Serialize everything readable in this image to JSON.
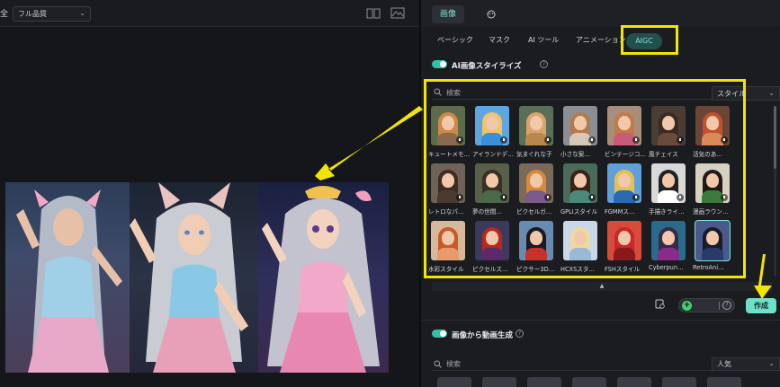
{
  "left_toolbar": {
    "label": "全",
    "quality": "フル品質",
    "split_icon": "split-view-icon",
    "image_icon": "snapshot-icon"
  },
  "preview": {
    "panels": [
      "original-photo",
      "illustration-style",
      "anime-style"
    ]
  },
  "top_tabs": {
    "image_tab": "画像",
    "color_icon": "palette-icon"
  },
  "sub_tabs": {
    "basic": "ベーシック",
    "mask": "マスク",
    "ai_tool": "AI ツール",
    "animation": "アニメーション",
    "aigc": "AIGC"
  },
  "section_style": {
    "title": "AI画像スタイライズ",
    "enabled": true
  },
  "search": {
    "placeholder": "検索",
    "sort": "スタイル"
  },
  "styles": [
    {
      "label": "キュートメモ…",
      "hair": "#c98a4a",
      "body": "#8a6a4a",
      "bg": "#5c6b4a"
    },
    {
      "label": "アイランドデ…",
      "hair": "#f2c46a",
      "body": "#3b8fd8",
      "bg": "#5fa6e0"
    },
    {
      "label": "気まぐれな子",
      "hair": "#d9a36a",
      "body": "#b8874e",
      "bg": "#5a6f58"
    },
    {
      "label": "小さな案…",
      "hair": "#b57a4c",
      "body": "#d8c8b8",
      "bg": "#8a8f96"
    },
    {
      "label": "ビンテージコ…",
      "hair": "#c27a4a",
      "body": "#c85a7a",
      "bg": "#a78d7a"
    },
    {
      "label": "風チェイス",
      "hair": "#3b2a22",
      "body": "#6a4a3a",
      "bg": "#4a3d36"
    },
    {
      "label": "活気のあ…",
      "hair": "#c0522e",
      "body": "#d88a5a",
      "bg": "#6a4538"
    },
    {
      "label": "レトロなパ…",
      "hair": "#3d2c22",
      "body": "#4a3a30",
      "bg": "#6f6258"
    },
    {
      "label": "夢の世間…",
      "hair": "#3a2e26",
      "body": "#4a6a4a",
      "bg": "#58604a"
    },
    {
      "label": "ピクセルガ…",
      "hair": "#d88a3a",
      "body": "#7a5a8a",
      "bg": "#7a6a5a"
    },
    {
      "label": "GPLIスタイル",
      "hair": "#3b2218",
      "body": "#4a8a7a",
      "bg": "#4a6a5a"
    },
    {
      "label": "FGMMス…",
      "hair": "#e8c050",
      "body": "#2a6ab0",
      "bg": "#5fa0d8"
    },
    {
      "label": "手描きライ…",
      "hair": "#222222",
      "body": "#ffffff",
      "bg": "#d8d8d8"
    },
    {
      "label": "漫画ラウン…",
      "hair": "#1f1a18",
      "body": "#3a7a3a",
      "bg": "#d8d0c0"
    },
    {
      "label": "水彩スタイル",
      "hair": "#c85a2a",
      "body": "#e89a6a",
      "bg": "#d8b89a"
    },
    {
      "label": "ピクセルス…",
      "hair": "#b8281e",
      "body": "#5a2a6a",
      "bg": "#3a3a5a"
    },
    {
      "label": "ピクサー3D…",
      "hair": "#1a1a22",
      "body": "#c8302a",
      "bg": "#6a8ab0"
    },
    {
      "label": "HCXSスタ…",
      "hair": "#f0d8a0",
      "body": "#9ab8d8",
      "bg": "#c8d8e8"
    },
    {
      "label": "FSHスタイル",
      "hair": "#c82828",
      "body": "#8a1a1a",
      "bg": "#d84a3a"
    },
    {
      "label": "Cyberpun…",
      "hair": "#3a2a4a",
      "body": "#8a2a8a",
      "bg": "#2a6a8a"
    },
    {
      "label": "RetroAni…",
      "hair": "#1a1a2a",
      "body": "#2a3a6a",
      "bg": "#4a5a8a"
    }
  ],
  "actions": {
    "credit_icon": "credit-icon",
    "create": "作成"
  },
  "section_video": {
    "title": "画像から動画生成",
    "enabled": true,
    "search_placeholder": "検索",
    "sort": "人気"
  }
}
